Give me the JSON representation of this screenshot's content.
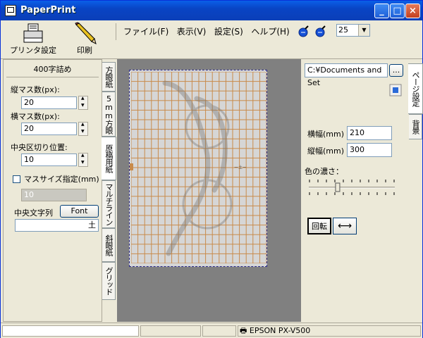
{
  "window": {
    "title": "PaperPrint"
  },
  "toolbar": {
    "printer_setup_label": "プリンタ設定",
    "print_label": "印刷",
    "zoom_value": "25",
    "colors": {
      "blue_tool": "#1550d6",
      "print_yellow": "#e8c020"
    }
  },
  "menu": {
    "items": [
      {
        "label": "ファイル(F)"
      },
      {
        "label": "表示(V)"
      },
      {
        "label": "設定(S)"
      },
      {
        "label": "ヘルプ(H)"
      }
    ]
  },
  "left_panel": {
    "header": "400字詰め",
    "cols_label": "縦マス数(px):",
    "cols_value": "20",
    "rows_label": "横マス数(px):",
    "rows_value": "20",
    "center_label": "中央区切り位置:",
    "center_value": "10",
    "mass_size_label": "マスサイズ指定(mm)",
    "mass_size_value": "10",
    "center_text_label": "中央文字列",
    "font_button": "Font",
    "center_text_value": "土"
  },
  "left_tabs": [
    {
      "label": "方眼紙"
    },
    {
      "label": "5mm方眼"
    },
    {
      "label": "原稿用紙"
    },
    {
      "label": "マルチライン"
    },
    {
      "label": "斜眼紙"
    },
    {
      "label": "グリッド"
    }
  ],
  "right_panel": {
    "path_value": "C:¥Documents and Set",
    "browse_button": "...",
    "width_label": "横幅(mm)",
    "width_value": "210",
    "height_label": "縦幅(mm)",
    "height_value": "300",
    "density_label": "色の濃さ：",
    "density_level": 0.33,
    "rotate_button": "回転",
    "swap_button": "⟷"
  },
  "right_tabs": [
    {
      "label": "ページ設定"
    },
    {
      "label": "背景"
    }
  ],
  "statusbar": {
    "printer": "EPSON PX-V500"
  },
  "paper": {
    "grid_color": "#c88a4a",
    "center_text": "ー土ー"
  }
}
